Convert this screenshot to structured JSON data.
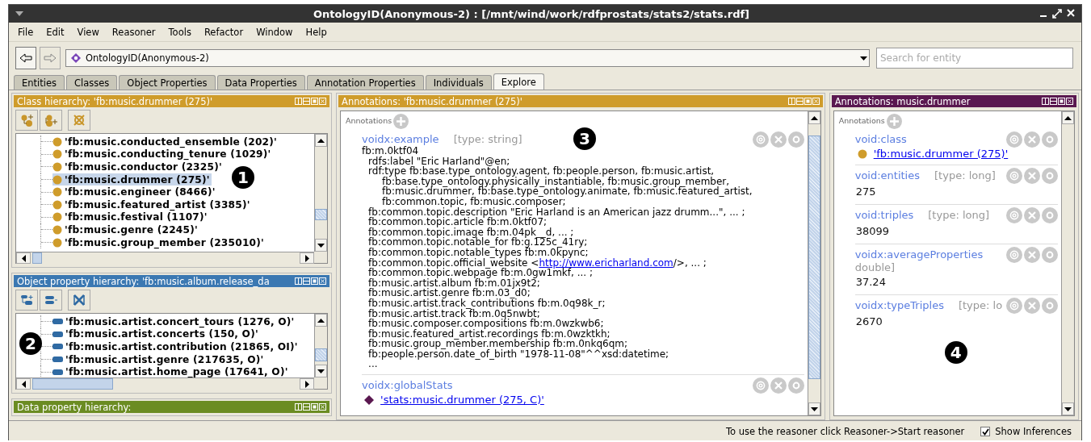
{
  "window": {
    "title": "OntologyID(Anonymous-2) : [/mnt/wind/work/rdfprostats/stats2/stats.rdf]"
  },
  "menu": [
    "File",
    "Edit",
    "View",
    "Reasoner",
    "Tools",
    "Refactor",
    "Window",
    "Help"
  ],
  "toolbar": {
    "ontology": "OntologyID(Anonymous-2)",
    "search": {
      "placeholder": "Search for entity"
    }
  },
  "tabs": [
    {
      "label": "Entities",
      "selected": false
    },
    {
      "label": "Classes",
      "selected": false
    },
    {
      "label": "Object Properties",
      "selected": false
    },
    {
      "label": "Data Properties",
      "selected": false
    },
    {
      "label": "Annotation Properties",
      "selected": false
    },
    {
      "label": "Individuals",
      "selected": false
    },
    {
      "label": "Explore",
      "selected": true
    }
  ],
  "class_hierarchy": {
    "kind": "class",
    "title": "Class hierarchy: 'fb:music.drummer (275)'",
    "color": "#cf9c2b",
    "callout": "1",
    "items": [
      {
        "label": "'fb:music.conducted_ensemble (202)'",
        "selected": false
      },
      {
        "label": "'fb:music.conducting_tenure (1029)'",
        "selected": false
      },
      {
        "label": "'fb:music.conductor (2325)'",
        "selected": false
      },
      {
        "label": "'fb:music.drummer (275)'",
        "selected": true
      },
      {
        "label": "'fb:music.engineer (8466)'",
        "selected": false
      },
      {
        "label": "'fb:music.featured_artist (3385)'",
        "selected": false
      },
      {
        "label": "'fb:music.festival (1107)'",
        "selected": false
      },
      {
        "label": "'fb:music.genre (2245)'",
        "selected": false
      },
      {
        "label": "'fb:music.group_member (235010)'",
        "selected": false
      }
    ]
  },
  "object_property_hierarchy": {
    "kind": "object_property",
    "title": "Object property hierarchy: 'fb:music.album.release_da",
    "color": "#3b78b2",
    "callout": "2",
    "items": [
      {
        "label": "'fb:music.artist.concert_tours (1276, O)'",
        "selected": false
      },
      {
        "label": "'fb:music.artist.concerts (150, O)'",
        "selected": false
      },
      {
        "label": "'fb:music.artist.contribution (21865, OI)'",
        "selected": false
      },
      {
        "label": "'fb:music.artist.genre (217635, O)'",
        "selected": false
      },
      {
        "label": "'fb:music.artist.home_page (17641, O)'",
        "selected": false
      }
    ]
  },
  "data_property_hierarchy": {
    "title": "Data property hierarchy:",
    "color": "#6b8c22"
  },
  "annotations": {
    "title": "Annotations: 'fb:music.drummer (275)'",
    "color": "#cf9c2b",
    "heading": "Annotations",
    "callout": "3",
    "entries": [
      {
        "kind": "literal",
        "property": "voidx:example",
        "type": "[type: string]",
        "subject": "fb:m.0ktf04",
        "statements": [
          {
            "kind": "text",
            "text": "rdfs:label \"Eric Harland\"@en;"
          },
          {
            "kind": "text",
            "text": "rdf:type fb:base.type_ontology.agent, fb:people.person, fb:music.artist,",
            "continued": [
              "fb:base.type_ontology.physically_instantiable, fb:music.group_member,",
              "fb:music.drummer, fb:base.type_ontology.animate, fb:music.featured_artist,",
              "fb:common.topic, fb:music.composer;"
            ]
          },
          {
            "kind": "text",
            "text": "fb:common.topic.description \"Eric Harland is an American jazz drumm...\", ... ;"
          },
          {
            "kind": "text",
            "text": "fb:common.topic.article fb:m.0ktf07;"
          },
          {
            "kind": "text",
            "text": "fb:common.topic.image fb:m.04pk__d, ... ;"
          },
          {
            "kind": "text",
            "text": "fb:common.topic.notable_for fb:g.125c_41ry;"
          },
          {
            "kind": "text",
            "text": "fb:common.topic.notable_types fb:m.0kpync;"
          },
          {
            "kind": "link",
            "text": "fb:common.topic.official_website <",
            "link": "http://www.ericharland.com",
            "after": "/>, ... ;"
          },
          {
            "kind": "text",
            "text": "fb:common.topic.webpage fb:m.0gw1mkf, ... ;"
          },
          {
            "kind": "text",
            "text": "fb:music.artist.album fb:m.01jx9t2;"
          },
          {
            "kind": "text",
            "text": "fb:music.artist.genre fb:m.03_d0;"
          },
          {
            "kind": "text",
            "text": "fb:music.artist.track_contributions fb:m.0q98k_r;"
          },
          {
            "kind": "text",
            "text": "fb:music.artist.track fb:m.0q5nwbt;"
          },
          {
            "kind": "text",
            "text": "fb:music.composer.compositions fb:m.0wzkwb6;"
          },
          {
            "kind": "text",
            "text": "fb:music.featured_artist.recordings fb:m.0wzktkh;"
          },
          {
            "kind": "text",
            "text": "fb:music.group_member.membership fb:m.0nkq6qm;"
          },
          {
            "kind": "text",
            "text": "fb:people.person.date_of_birth \"1978-11-08\"^^xsd:datetime;"
          }
        ],
        "ellipsis": "..."
      },
      {
        "kind": "individual_link",
        "property": "voidx:globalStats",
        "entity": "'stats:music.drummer (275, C)'"
      }
    ]
  },
  "entity_annotations": {
    "title": "Annotations: music.drummer",
    "color": "#5a1850",
    "heading": "Annotations",
    "callout": "4",
    "entries": [
      {
        "kind": "class_link",
        "property": "void:class",
        "entity": "'fb:music.drummer (275)'"
      },
      {
        "kind": "literal",
        "property": "void:entities",
        "type": "[type: long]",
        "value": "275"
      },
      {
        "kind": "literal",
        "property": "void:triples",
        "type": "[type: long]",
        "value": "38099"
      },
      {
        "kind": "literal",
        "property": "voidx:averageProperties",
        "type": "double]",
        "value": "37.24"
      },
      {
        "kind": "literal",
        "property": "voidx:typeTriples",
        "type": "[type: lo",
        "value": "2670"
      }
    ]
  },
  "status_bar": {
    "message": "To use the reasoner click Reasoner->Start reasoner",
    "show_inferences": {
      "label": "Show Inferences",
      "checked": true
    }
  }
}
